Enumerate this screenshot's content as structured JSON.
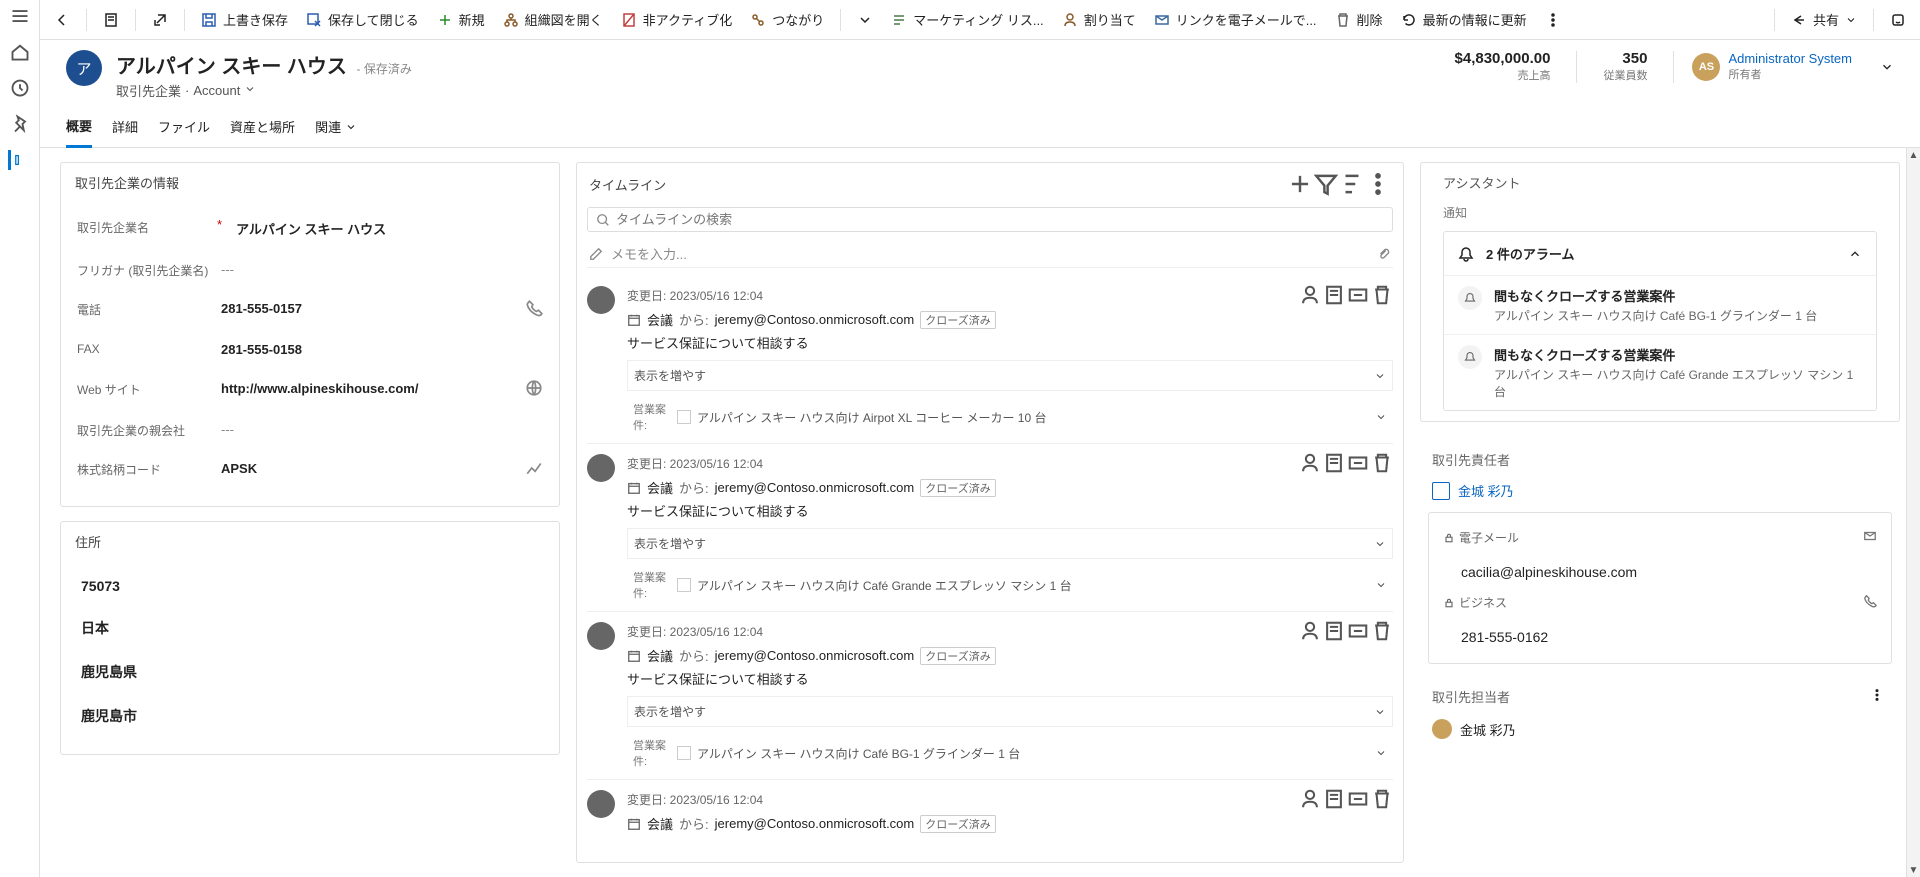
{
  "toolbar": {
    "save": "上書き保存",
    "save_close": "保存して閉じる",
    "new": "新規",
    "open_org": "組織図を開く",
    "deactivate": "非アクティブ化",
    "connections": "つながり",
    "marketing": "マーケティング リス...",
    "assign": "割り当て",
    "email_link": "リンクを電子メールで...",
    "delete": "削除",
    "refresh": "最新の情報に更新",
    "share": "共有"
  },
  "header": {
    "avatar_letter": "ア",
    "title": "アルパイン スキー ハウス",
    "saved": "- 保存済み",
    "entity": "取引先企業",
    "form": "Account",
    "kpi1_value": "$4,830,000.00",
    "kpi1_label": "売上高",
    "kpi2_value": "350",
    "kpi2_label": "従業員数",
    "owner_avatar": "AS",
    "owner_name": "Administrator System",
    "owner_role": "所有者"
  },
  "tabs": {
    "t0": "概要",
    "t1": "詳細",
    "t2": "ファイル",
    "t3": "資産と場所",
    "t4": "関連"
  },
  "info": {
    "section": "取引先企業の情報",
    "name_label": "取引先企業名",
    "name_value": "アルパイン スキー ハウス",
    "furigana_label": "フリガナ (取引先企業名)",
    "furigana_value": "---",
    "phone_label": "電話",
    "phone_value": "281-555-0157",
    "fax_label": "FAX",
    "fax_value": "281-555-0158",
    "web_label": "Web サイト",
    "web_value": "http://www.alpineskihouse.com/",
    "parent_label": "取引先企業の親会社",
    "parent_value": "---",
    "ticker_label": "株式銘柄コード",
    "ticker_value": "APSK"
  },
  "address": {
    "section": "住所",
    "postal": "75073",
    "country": "日本",
    "pref": "鹿児島県",
    "city": "鹿児島市"
  },
  "timeline": {
    "title": "タイムライン",
    "search_ph": "タイムラインの検索",
    "note_ph": "メモを入力...",
    "more": "表示を増やす",
    "opp_label": "営業案件:",
    "items": [
      {
        "date": "変更日: 2023/05/16 12:04",
        "type": "会議",
        "from_label": "から:",
        "from": "jeremy@Contoso.onmicrosoft.com",
        "status": "クローズ済み",
        "subject": "サービス保証について相談する",
        "opp": "アルパイン スキー ハウス向け Airpot XL コーヒー メーカー 10 台"
      },
      {
        "date": "変更日: 2023/05/16 12:04",
        "type": "会議",
        "from_label": "から:",
        "from": "jeremy@Contoso.onmicrosoft.com",
        "status": "クローズ済み",
        "subject": "サービス保証について相談する",
        "opp": "アルパイン スキー ハウス向け Café Grande エスプレッソ マシン 1 台"
      },
      {
        "date": "変更日: 2023/05/16 12:04",
        "type": "会議",
        "from_label": "から:",
        "from": "jeremy@Contoso.onmicrosoft.com",
        "status": "クローズ済み",
        "subject": "サービス保証について相談する",
        "opp": "アルパイン スキー ハウス向け Café BG-1 グラインダー 1 台"
      },
      {
        "date": "変更日: 2023/05/16 12:04",
        "type": "会議",
        "from_label": "から:",
        "from": "jeremy@Contoso.onmicrosoft.com",
        "status": "クローズ済み",
        "subject": "",
        "opp": ""
      }
    ]
  },
  "assistant": {
    "title": "アシスタント",
    "notif": "通知",
    "alarm_header": "2 件のアラーム",
    "alarms": [
      {
        "t1": "間もなくクローズする営業案件",
        "t2": "アルパイン スキー ハウス向け Café BG-1 グラインダー 1 台"
      },
      {
        "t1": "間もなくクローズする営業案件",
        "t2": "アルパイン スキー ハウス向け Café Grande エスプレッソ マシン 1 台"
      }
    ],
    "primary_contact_label": "取引先責任者",
    "primary_contact_name": "金城 彩乃",
    "email_label": "電子メール",
    "email_value": "cacilia@alpineskihouse.com",
    "business_label": "ビジネス",
    "business_value": "281-555-0162",
    "contacts_label": "取引先担当者",
    "contact0": "金城 彩乃"
  }
}
